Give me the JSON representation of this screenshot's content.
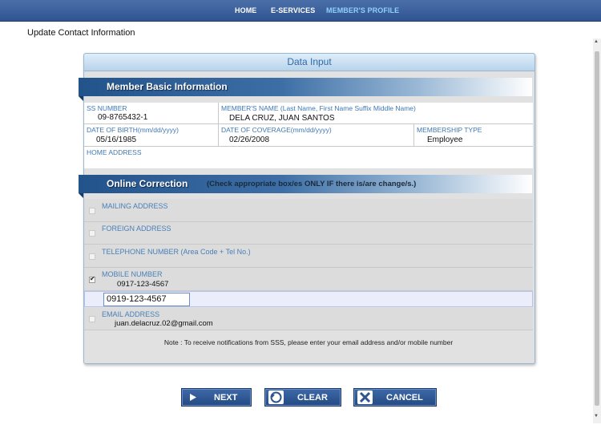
{
  "nav": {
    "items": [
      {
        "label": "HOME"
      },
      {
        "label": "E-SERVICES"
      },
      {
        "label": "MEMBER'S PROFILE"
      }
    ]
  },
  "page": {
    "title": "Update Contact Information"
  },
  "panel": {
    "title": "Data Input"
  },
  "basic": {
    "title": "Member Basic Information",
    "ss_label": "SS NUMBER",
    "ss_value": "09-8765432-1",
    "name_label": "MEMBER'S NAME  (Last Name, First Name Suffix Middle Name)",
    "name_value": "DELA CRUZ, JUAN SANTOS",
    "dob_label": "DATE OF BIRTH(mm/dd/yyyy)",
    "dob_value": "05/16/1985",
    "doc_label": "DATE OF COVERAGE(mm/dd/yyyy)",
    "doc_value": "02/26/2008",
    "mtype_label": "MEMBERSHIP TYPE",
    "mtype_value": "Employee",
    "addr_label": "HOME ADDRESS"
  },
  "correction": {
    "title": "Online Correction",
    "note": "(Check appropriate box/es ONLY IF there is/are change/s.)",
    "mailing_label": "MAILING ADDRESS",
    "foreign_label": "FOREIGN ADDRESS",
    "telephone_label": "TELEPHONE NUMBER (Area Code + Tel No.)",
    "mobile_label": "MOBILE NUMBER",
    "mobile_current": "0917-123-4567",
    "mobile_new": "0919-123-4567",
    "email_label": "EMAIL ADDRESS",
    "email_current": "juan.delacruz.02@gmail.com",
    "footer_note": "Note : To receive notifications from SSS, please enter your email address and/or mobile number"
  },
  "buttons": {
    "next": "NEXT",
    "clear": "CLEAR",
    "cancel": "CANCEL"
  }
}
